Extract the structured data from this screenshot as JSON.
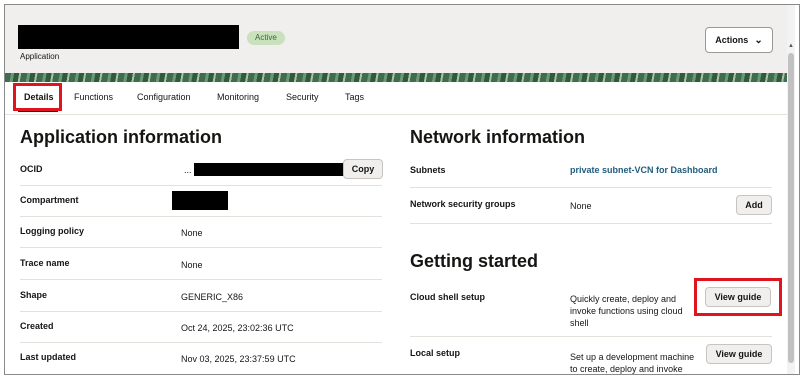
{
  "header": {
    "status": "Active",
    "subtitle": "Application",
    "actions_label": "Actions"
  },
  "tabs": [
    {
      "label": "Details"
    },
    {
      "label": "Functions"
    },
    {
      "label": "Configuration"
    },
    {
      "label": "Monitoring"
    },
    {
      "label": "Security"
    },
    {
      "label": "Tags"
    }
  ],
  "app_info": {
    "title": "Application information",
    "ocid": {
      "label": "OCID",
      "prefix": "...",
      "copy_label": "Copy"
    },
    "compartment": {
      "label": "Compartment"
    },
    "logging": {
      "label": "Logging policy",
      "value": "None"
    },
    "trace": {
      "label": "Trace name",
      "value": "None"
    },
    "shape": {
      "label": "Shape",
      "value": "GENERIC_X86"
    },
    "created": {
      "label": "Created",
      "value": "Oct 24, 2025, 23:02:36 UTC"
    },
    "updated": {
      "label": "Last updated",
      "value": "Nov 03, 2025, 23:37:59 UTC"
    }
  },
  "network": {
    "title": "Network information",
    "subnets": {
      "label": "Subnets",
      "value": "private subnet-VCN for Dashboard"
    },
    "nsg": {
      "label": "Network security groups",
      "value": "None",
      "add_label": "Add"
    }
  },
  "getting_started": {
    "title": "Getting started",
    "cloud_shell": {
      "label": "Cloud shell setup",
      "desc": "Quickly create, deploy and invoke functions using cloud shell",
      "button": "View guide"
    },
    "local": {
      "label": "Local setup",
      "desc": "Set up a development machine to create, deploy and invoke",
      "button": "View guide"
    }
  },
  "colors": {
    "highlight": "#e0141e",
    "link": "#1f5d7c",
    "badge_bg": "#c9e1bd"
  }
}
